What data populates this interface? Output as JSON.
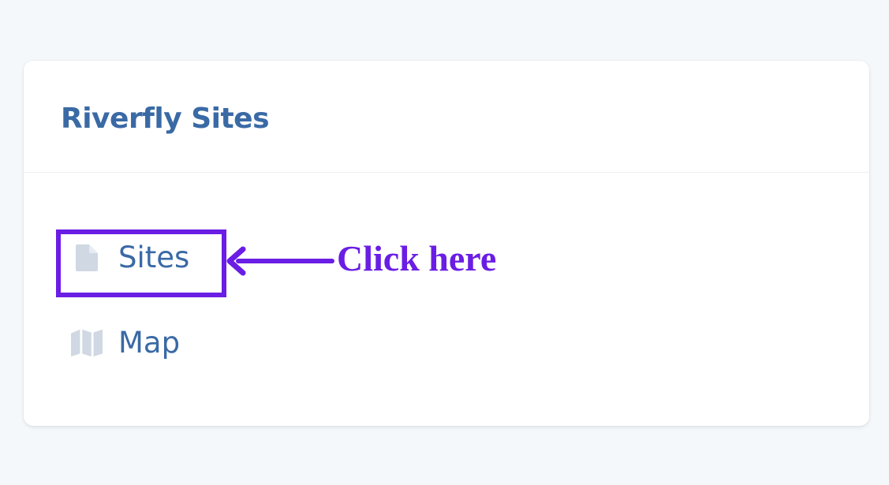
{
  "card": {
    "title": "Riverfly Sites"
  },
  "nav": {
    "items": [
      {
        "label": "Sites",
        "icon": "file-icon"
      },
      {
        "label": "Map",
        "icon": "map-icon"
      }
    ]
  },
  "annotation": {
    "text": "Click here",
    "color": "#6a1de4"
  },
  "colors": {
    "title": "#3a6aa5",
    "icon": "#cfd8e3",
    "background": "#f5f8fb"
  }
}
